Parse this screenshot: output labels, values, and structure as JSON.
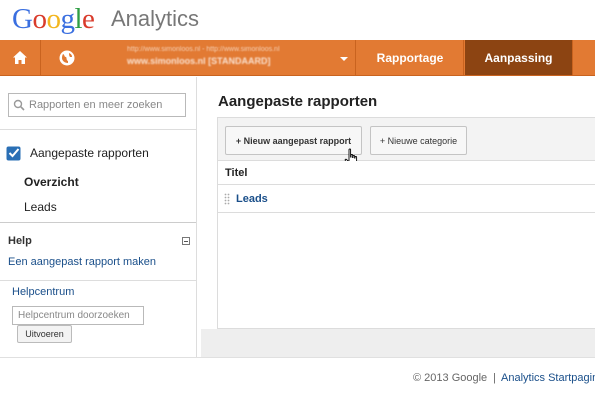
{
  "brand": {
    "logo_letters": [
      "G",
      "o",
      "o",
      "g",
      "l",
      "e"
    ],
    "product_name": "Analytics",
    "logo_colors": [
      "#3a6fe0",
      "#d93b2b",
      "#f3b61f",
      "#3a6fe0",
      "#2f9e44",
      "#d93b2b"
    ]
  },
  "navbar": {
    "color": "#e27a33",
    "active_color": "#8c4412",
    "account": {
      "line1": "http://www.simonloos.nl - http://www.simonloos.nl",
      "line2": "www.simonloos.nl [STANDAARD]"
    },
    "tabs": [
      {
        "label": "Rapportage",
        "active": false
      },
      {
        "label": "Aanpassing",
        "active": true
      }
    ]
  },
  "sidebar": {
    "search_placeholder": "Rapporten en meer zoeken",
    "section_title": "Aangepaste rapporten",
    "items": [
      {
        "label": "Overzicht",
        "selected": true
      },
      {
        "label": "Leads",
        "selected": false
      }
    ],
    "help": {
      "title": "Help",
      "link": "Een aangepast rapport maken",
      "helpcenter_link": "Helpcentrum",
      "helpcenter_placeholder": "Helpcentrum doorzoeken",
      "submit_label": "Uitvoeren"
    }
  },
  "main": {
    "title": "Aangepaste rapporten",
    "buttons": {
      "new_report": "+ Nieuw aangepast rapport",
      "new_category": "+ Nieuwe categorie"
    },
    "table": {
      "column": "Titel",
      "rows": [
        {
          "title": "Leads"
        }
      ]
    }
  },
  "footer": {
    "copyright": "© 2013 Google",
    "separator": "|",
    "link": "Analytics Startpagina"
  }
}
